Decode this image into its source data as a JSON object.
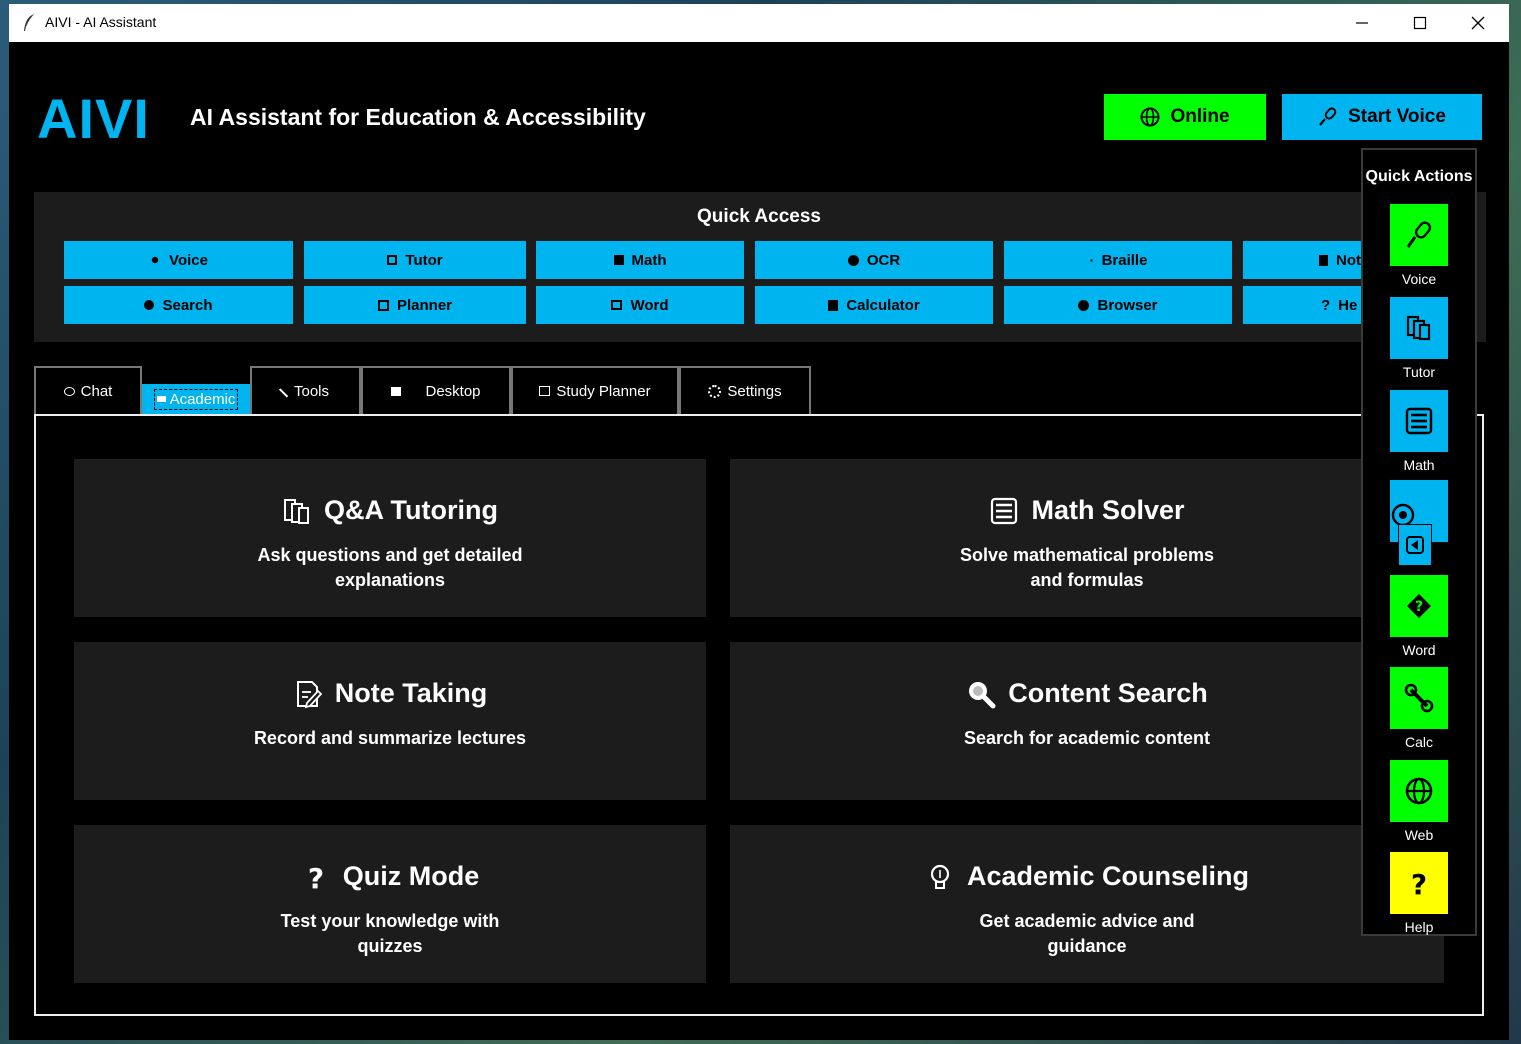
{
  "window": {
    "title": "AIVI - AI Assistant"
  },
  "header": {
    "logo": "AIVI",
    "subtitle": "AI Assistant for Education & Accessibility",
    "online_label": "Online",
    "start_voice_label": "Start Voice"
  },
  "quick_access": {
    "title": "Quick Access",
    "row1": [
      "Voice",
      "Tutor",
      "Math",
      "OCR",
      "Braille",
      "Not"
    ],
    "row2": [
      "Search",
      "Planner",
      "Word",
      "Calculator",
      "Browser",
      "He"
    ]
  },
  "tabs": [
    "Chat",
    "Academic",
    "Tools",
    "Desktop",
    "Study Planner",
    "Settings"
  ],
  "active_tab": "Academic",
  "cards": [
    {
      "title": "Q&A Tutoring",
      "desc": "Ask questions and get detailed explanations",
      "icon": "book-icon"
    },
    {
      "title": "Math Solver",
      "desc": "Solve mathematical problems and formulas",
      "icon": "abacus-icon"
    },
    {
      "title": "Note Taking",
      "desc": "Record and summarize lectures",
      "icon": "note-icon"
    },
    {
      "title": "Content Search",
      "desc": "Search for academic content",
      "icon": "search-icon"
    },
    {
      "title": "Quiz Mode",
      "desc": "Test your knowledge with quizzes",
      "icon": "question-icon"
    },
    {
      "title": "Academic Counseling",
      "desc": "Get academic advice and guidance",
      "icon": "lightbulb-icon"
    }
  ],
  "quick_actions": {
    "title": "Quick Actions",
    "items": [
      {
        "label": "Voice",
        "icon": "microphone-icon",
        "color": "#00ff00"
      },
      {
        "label": "Tutor",
        "icon": "book-icon",
        "color": "#00b4f0"
      },
      {
        "label": "Math",
        "icon": "abacus-icon",
        "color": "#00b4f0"
      },
      {
        "label": "",
        "icon": "eye-icon",
        "color": "#00b4f0"
      },
      {
        "label": "Word",
        "icon": "diamond-icon",
        "color": "#00ff00"
      },
      {
        "label": "Calc",
        "icon": "wrench-icon",
        "color": "#00ff00"
      },
      {
        "label": "Web",
        "icon": "globe-icon",
        "color": "#00ff00"
      },
      {
        "label": "Help",
        "icon": "question-icon",
        "color": "#ffff00"
      }
    ]
  },
  "colors": {
    "accent_blue": "#00b4f0",
    "accent_green": "#00ff00",
    "help_yellow": "#ffff00",
    "card_bg": "#1c1c1c"
  }
}
